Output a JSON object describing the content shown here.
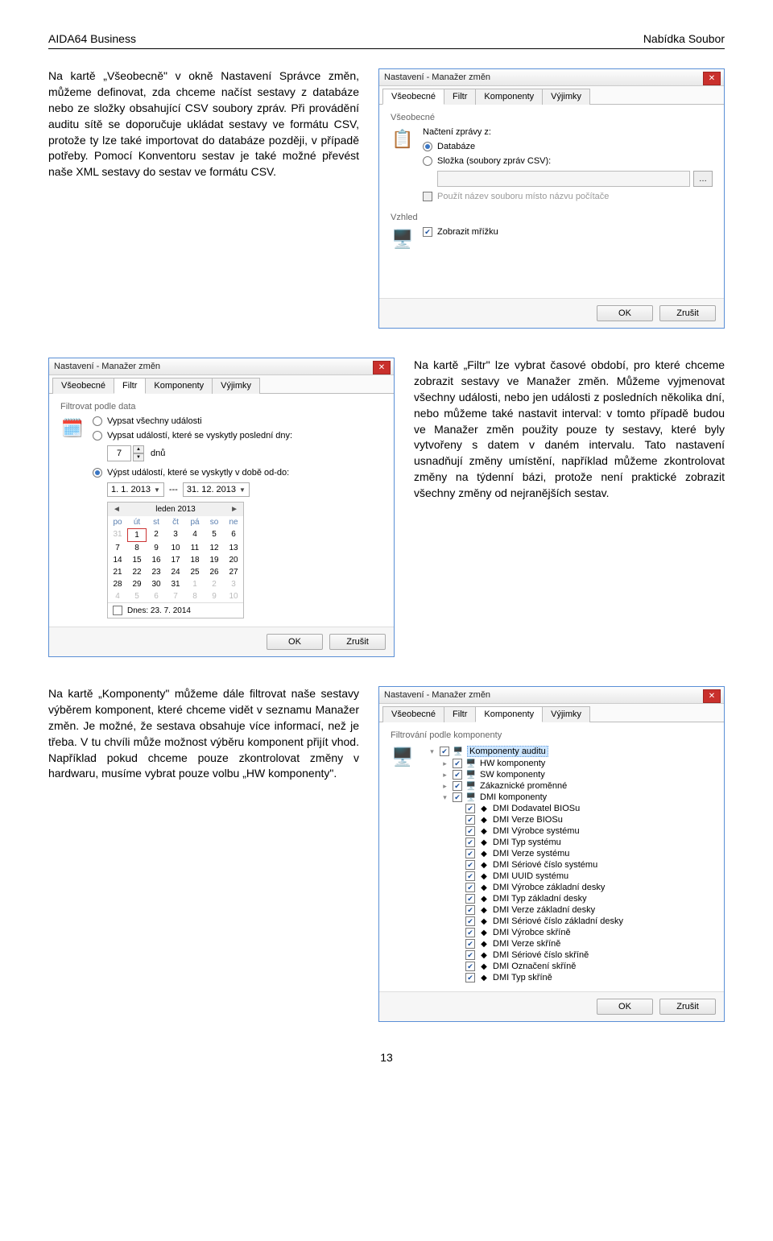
{
  "header": {
    "left": "AIDA64 Business",
    "right": "Nabídka Soubor"
  },
  "section1": {
    "text": "Na kartě „Všeobecně\" v okně Nastavení Správce změn, můžeme definovat, zda chceme načíst sestavy z databáze nebo ze složky obsahující CSV soubory zpráv. Při provádění auditu sítě se doporučuje ukládat sestavy ve formátu CSV, protože ty lze také importovat do databáze později, v případě potřeby. Pomocí Konventoru sestav je také možné převést naše XML sestavy do sestav ve formátu CSV."
  },
  "section2": {
    "text": "Na kartě „Filtr\" lze vybrat časové období, pro které chceme zobrazit sestavy ve Manažer změn. Můžeme vyjmenovat všechny události, nebo jen události z posledních několika dní, nebo můžeme také nastavit interval: v tomto případě budou ve Manažer změn použity pouze ty sestavy, které byly vytvořeny s datem v daném intervalu. Tato nastavení usnadňují změny umístění, například můžeme zkontrolovat změny na týdenní bázi, protože není praktické zobrazit všechny změny od nejranějších sestav."
  },
  "section3": {
    "text": "Na kartě „Komponenty\" můžeme dále filtrovat naše sestavy výběrem komponent, které chceme vidět v seznamu Manažer změn. Je možné, že sestava obsahuje více informací, než je třeba. V tu chvíli může možnost výběru komponent přijít vhod. Například pokud chceme pouze zkontrolovat změny v hardwaru, musíme vybrat pouze volbu „HW komponenty\"."
  },
  "dialog_common": {
    "title": "Nastavení - Manažer změn",
    "tabs": [
      "Všeobecné",
      "Filtr",
      "Komponenty",
      "Výjimky"
    ],
    "ok": "OK",
    "cancel": "Zrušit"
  },
  "dlg1": {
    "group": "Všeobecné",
    "load_label": "Načtení zprávy z:",
    "opt_db": "Databáze",
    "opt_folder": "Složka (soubory zpráv CSV):",
    "use_file_name": "Použít název souboru místo názvu počítače",
    "view": "Vzhled",
    "show_grid": "Zobrazit mřížku"
  },
  "dlg2": {
    "group": "Filtrovat podle data",
    "opt_all": "Vypsat všechny události",
    "opt_lastn": "Vypsat událostí, které se vyskytly poslední dny:",
    "days_value": "7",
    "days_unit": "dnů",
    "opt_range": "Výpst událostí, které se vyskytly v době od-do:",
    "date_from": "1. 1. 2013",
    "date_to": "31. 12. 2013",
    "cal_title": "leden 2013",
    "cal_dayheads": [
      "po",
      "út",
      "st",
      "čt",
      "pá",
      "so",
      "ne"
    ],
    "cal_rows": [
      [
        "31",
        "1",
        "2",
        "3",
        "4",
        "5",
        "6"
      ],
      [
        "7",
        "8",
        "9",
        "10",
        "11",
        "12",
        "13"
      ],
      [
        "14",
        "15",
        "16",
        "17",
        "18",
        "19",
        "20"
      ],
      [
        "21",
        "22",
        "23",
        "24",
        "25",
        "26",
        "27"
      ],
      [
        "28",
        "29",
        "30",
        "31",
        "1",
        "2",
        "3"
      ],
      [
        "4",
        "5",
        "6",
        "7",
        "8",
        "9",
        "10"
      ]
    ],
    "cal_today": "Dnes: 23. 7. 2014"
  },
  "dlg3": {
    "group": "Filtrování podle komponenty",
    "items": [
      "Komponenty auditu",
      "HW komponenty",
      "SW komponenty",
      "Zákaznické proměnné",
      "DMI komponenty",
      "DMI Dodavatel BIOSu",
      "DMI Verze BIOSu",
      "DMI Výrobce systému",
      "DMI Typ systému",
      "DMI Verze systému",
      "DMI Sériové číslo systému",
      "DMI UUID systému",
      "DMI Výrobce základní desky",
      "DMI Typ základní desky",
      "DMI Verze základní desky",
      "DMI Sériové číslo základní desky",
      "DMI Výrobce skříně",
      "DMI Verze skříně",
      "DMI Sériové číslo skříně",
      "DMI Označení skříně",
      "DMI Typ skříně"
    ]
  },
  "page_number": "13"
}
